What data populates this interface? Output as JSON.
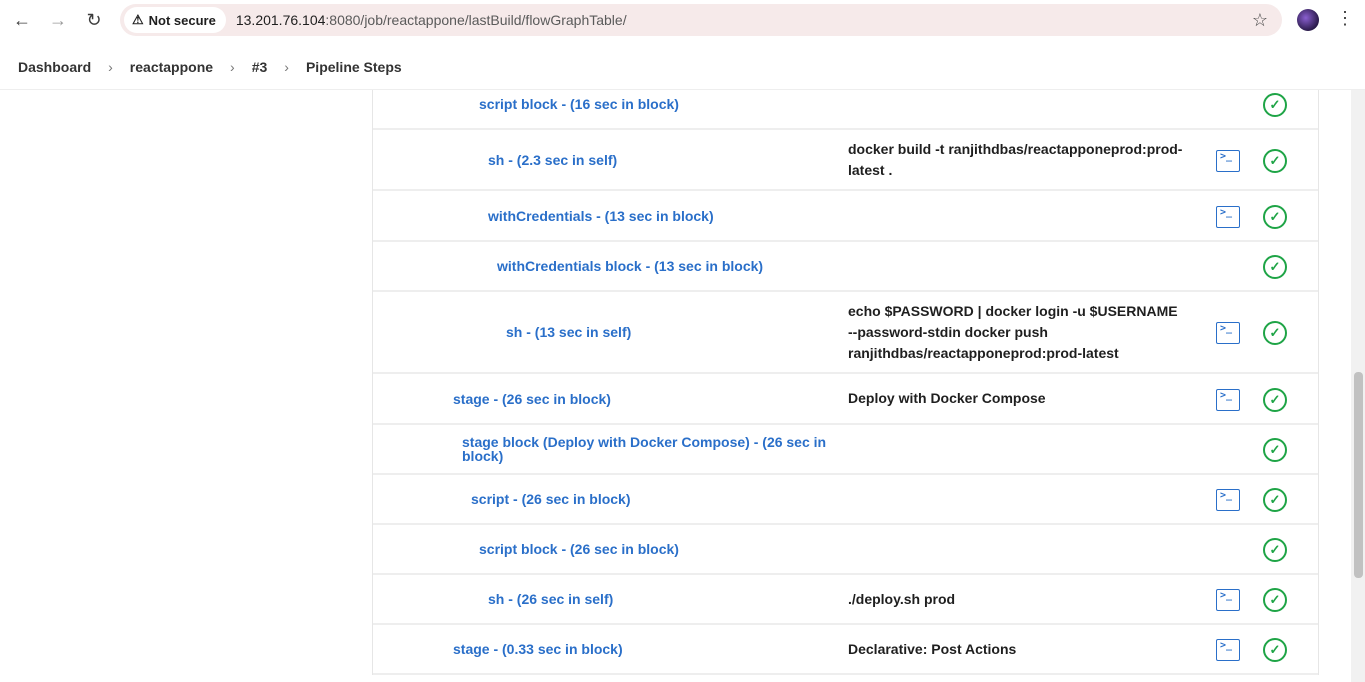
{
  "browser": {
    "security_label": "Not secure",
    "url_host": "13.201.76.104",
    "url_rest": ":8080/job/reactappone/lastBuild/flowGraphTable/"
  },
  "breadcrumb": [
    "Dashboard",
    "reactappone",
    "#3",
    "Pipeline Steps"
  ],
  "rows": [
    {
      "step": "script block - (16 sec in block)",
      "args": "",
      "console": false
    },
    {
      "step": "sh - (2.3 sec in self)",
      "args": "docker build -t ranjithdbas/reactapponeprod:prod-latest .",
      "console": true
    },
    {
      "step": "withCredentials - (13 sec in block)",
      "args": "",
      "console": true
    },
    {
      "step": "withCredentials block - (13 sec in block)",
      "args": "",
      "console": false
    },
    {
      "step": "sh - (13 sec in self)",
      "args": "echo $PASSWORD | docker login -u $USERNAME --password-stdin docker push ranjithdbas/reactapponeprod:prod-latest",
      "console": true
    },
    {
      "step": "stage - (26 sec in block)",
      "args": "Deploy with Docker Compose",
      "console": true
    },
    {
      "step": "stage block (Deploy with Docker Compose) - (26 sec in block)",
      "args": "",
      "console": false
    },
    {
      "step": "script - (26 sec in block)",
      "args": "",
      "console": true
    },
    {
      "step": "script block - (26 sec in block)",
      "args": "",
      "console": false
    },
    {
      "step": "sh - (26 sec in self)",
      "args": "./deploy.sh prod",
      "console": true
    },
    {
      "step": "stage - (0.33 sec in block)",
      "args": "Declarative: Post Actions",
      "console": true
    }
  ],
  "icons": {
    "console": "terminal-console-icon",
    "status": "success-check-icon"
  },
  "colors": {
    "link": "#2a6fc9",
    "success": "#1ea446"
  }
}
